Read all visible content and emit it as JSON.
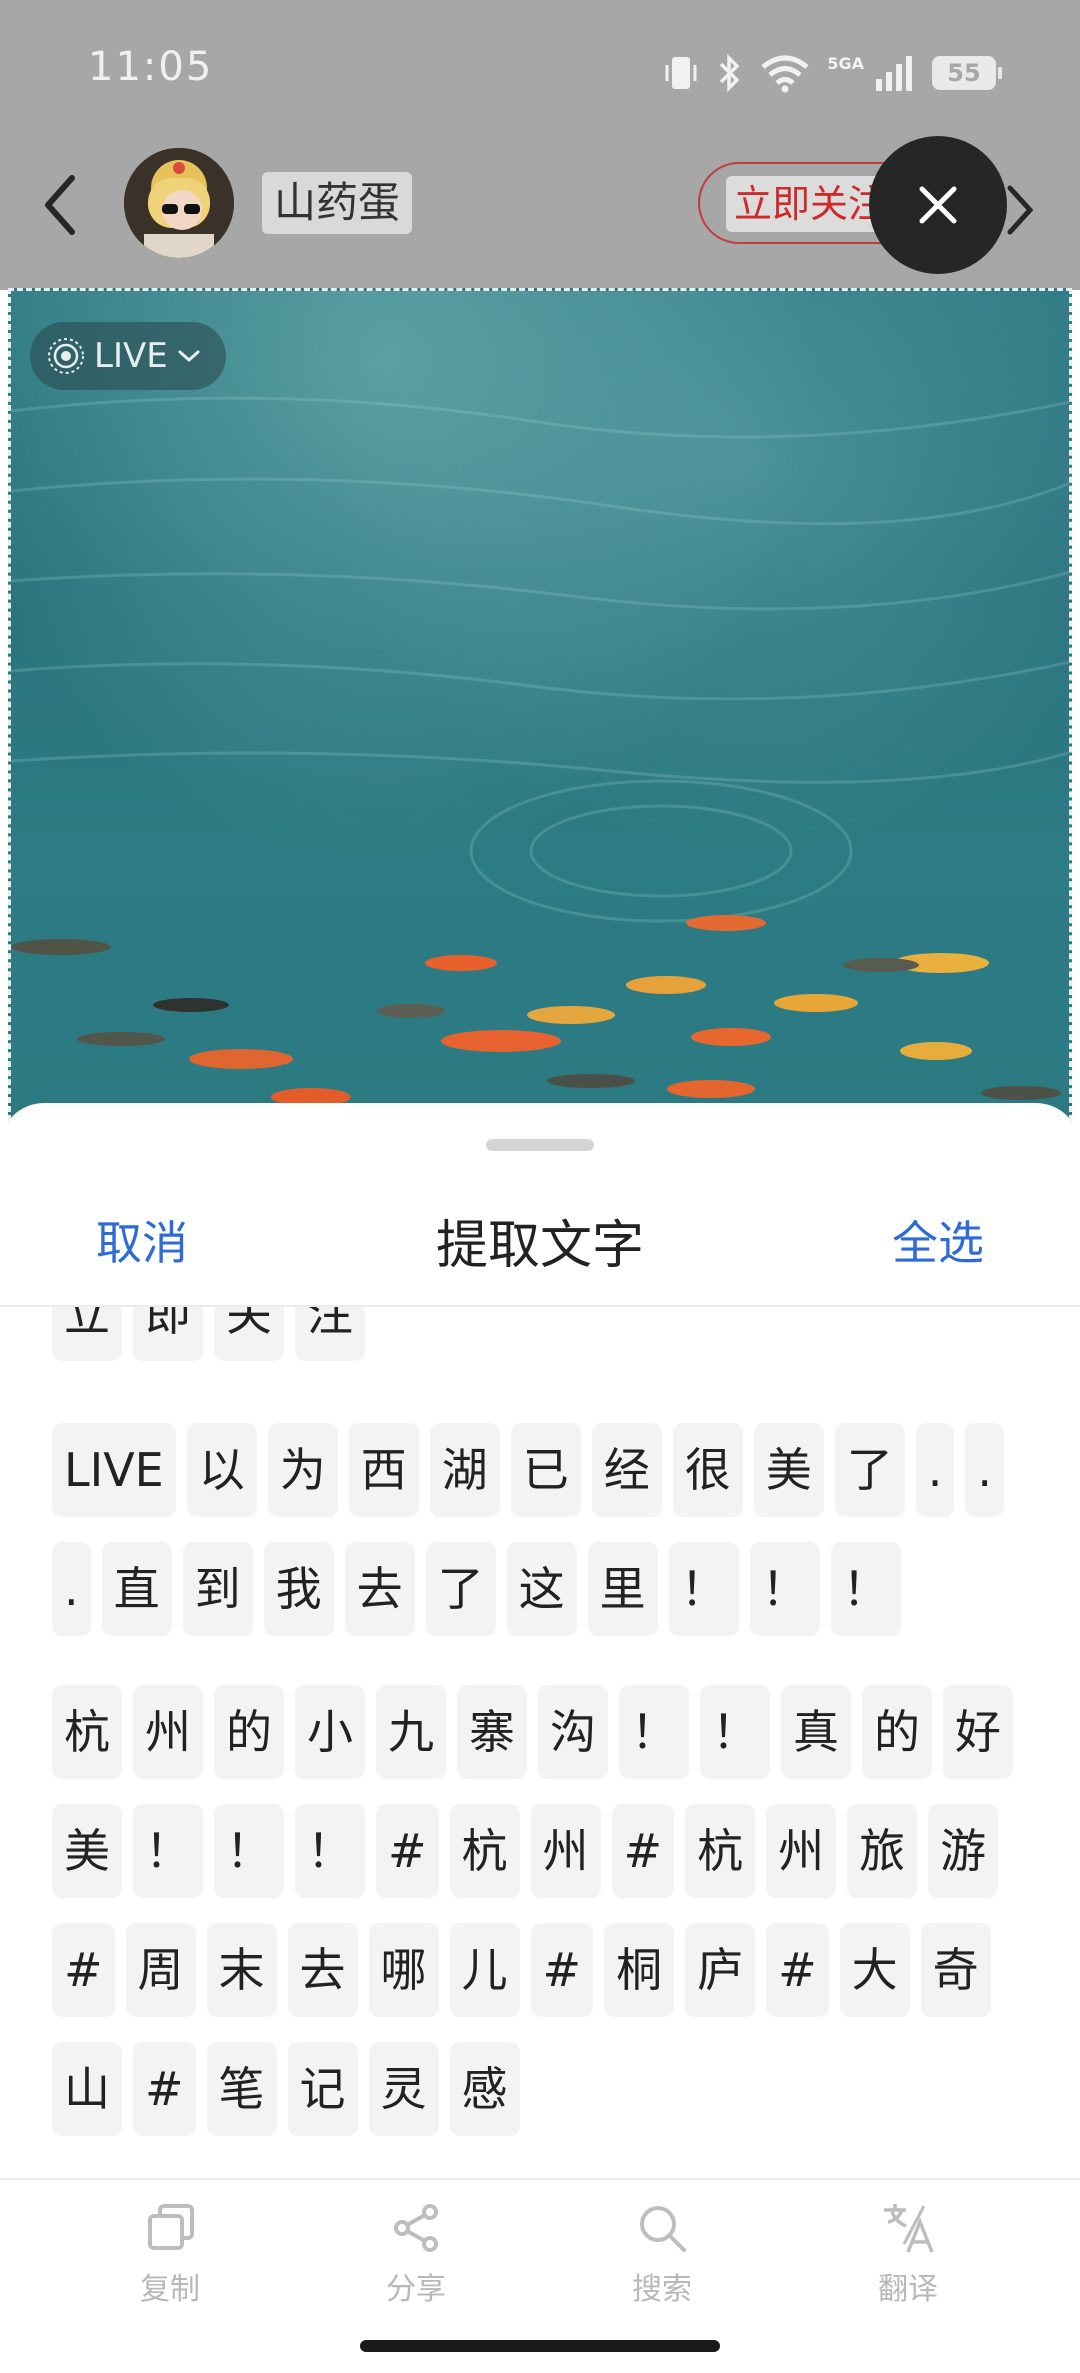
{
  "status_bar": {
    "time": "11:05",
    "network": "5GA",
    "battery": "55"
  },
  "header": {
    "author_name": "山药蛋",
    "follow_label": "立即关注"
  },
  "photo": {
    "live_label": "LIVE"
  },
  "sheet": {
    "cancel_label": "取消",
    "title": "提取文字",
    "select_all_label": "全选",
    "rows": [
      [
        "立",
        "即",
        "关",
        "注"
      ],
      [
        "LIVE",
        "以",
        "为",
        "西",
        "湖",
        "已",
        "经",
        "很",
        "美",
        "了",
        ".",
        "."
      ],
      [
        ".",
        "直",
        "到",
        "我",
        "去",
        "了",
        "这",
        "里",
        "！",
        "！",
        "！"
      ],
      [
        "杭",
        "州",
        "的",
        "小",
        "九",
        "寨",
        "沟",
        "！",
        "！",
        "真",
        "的",
        "好"
      ],
      [
        "美",
        "！",
        "！",
        "！",
        "#",
        "杭",
        "州",
        "#",
        "杭",
        "州",
        "旅",
        "游"
      ],
      [
        "#",
        "周",
        "末",
        "去",
        "哪",
        "儿",
        "#",
        "桐",
        "庐",
        "#",
        "大",
        "奇"
      ],
      [
        "山",
        "#",
        "笔",
        "记",
        "灵",
        "感"
      ]
    ]
  },
  "toolbar": {
    "copy_label": "复制",
    "share_label": "分享",
    "search_label": "搜索",
    "translate_label": "翻译"
  }
}
